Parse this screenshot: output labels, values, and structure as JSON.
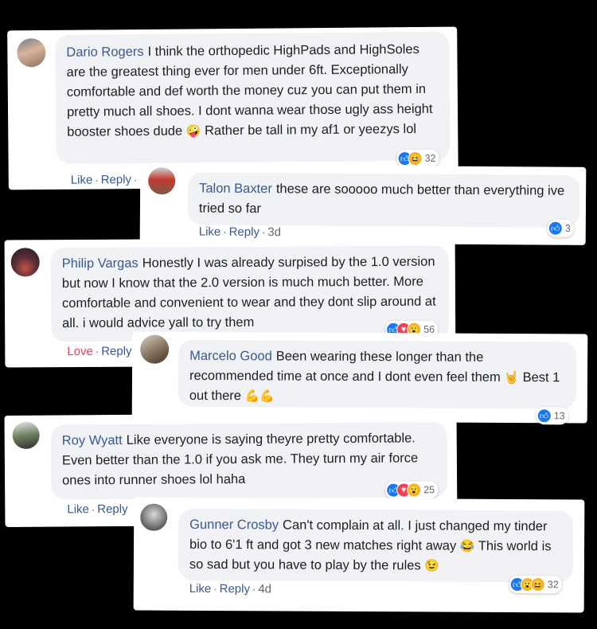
{
  "comments": [
    {
      "name": "Dario Rogers",
      "text": "I think the orthopedic HighPads and HighSoles are the greatest thing ever for men under 6ft. Exceptionally comfortable and def worth the money cuz you can put them in pretty much all shoes. I dont wanna wear those ugly ass height booster shoes dude",
      "emoji": "🤪",
      "text_after": "Rather be tall in my af1 or yeezys lol",
      "like_label": "Like",
      "reply_label": "Reply",
      "reaction_count": "32",
      "reactions": [
        "like-icon",
        "haha-icon"
      ]
    },
    {
      "name": "Talon Baxter",
      "text": "these are sooooo much better than everything ive tried so far",
      "like_label": "Like",
      "reply_label": "Reply",
      "age": "3d",
      "reaction_count": "3",
      "reactions": [
        "like-icon"
      ]
    },
    {
      "name": "Philip Vargas",
      "text": "Honestly I was already surpised by the 1.0 version but now I know that the 2.0 version is much much better. More comfortable and convenient to wear and they dont slip around at all. i would advice yall to try them",
      "like_label": "Love",
      "reply_label": "Reply",
      "reaction_count": "56",
      "reactions": [
        "like-icon",
        "love-icon",
        "wow-icon"
      ]
    },
    {
      "name": "Marcelo Good",
      "text": "Been wearing these longer than the recommended time at once and I dont even feel them",
      "emoji": "🤘",
      "text_after": "Best 1 out there",
      "emoji_after": "💪💪",
      "reaction_count": "13",
      "reactions": [
        "like-icon"
      ]
    },
    {
      "name": "Roy Wyatt",
      "text": "Like everyone is saying theyre pretty comfortable. Even better than the 1.0 if you ask me. They turn my air force ones into runner shoes lol haha",
      "like_label": "Like",
      "reply_label": "Reply",
      "reaction_count": "25",
      "reactions": [
        "like-icon",
        "love-icon",
        "wow-icon"
      ]
    },
    {
      "name": "Gunner Crosby",
      "text": "Can't complain at all. I just changed my tinder bio to 6'1 ft and got 3 new matches right away",
      "emoji": "😂",
      "text_after": "This world is so sad but you have to play by the rules",
      "emoji_after": "😉",
      "like_label": "Like",
      "reply_label": "Reply",
      "age": "4d",
      "reaction_count": "32",
      "reactions": [
        "like-icon",
        "wow-icon",
        "haha-icon"
      ]
    }
  ],
  "colors": {
    "name_blue": "#385898",
    "bubble_bg": "#f0f2f5",
    "like_blue": "#1877f2",
    "love_red": "#f33e58",
    "haha_yellow": "#f7b125"
  }
}
